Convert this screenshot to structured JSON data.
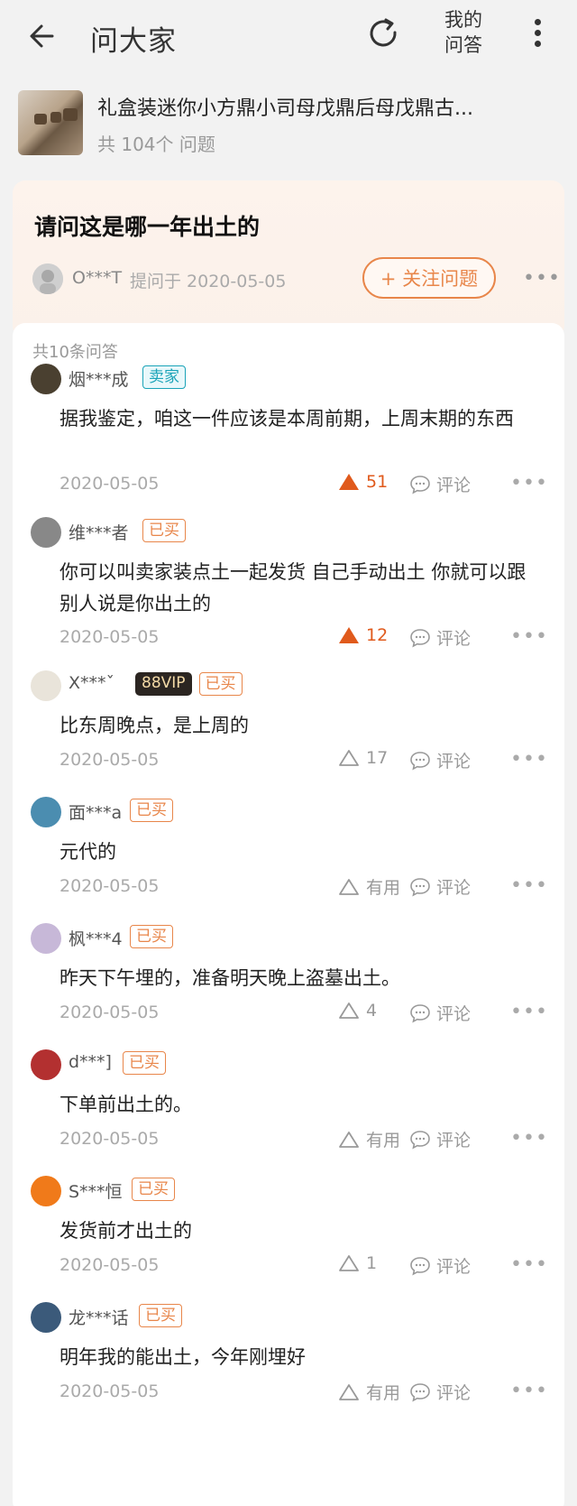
{
  "header": {
    "title": "问大家",
    "my_qa_line1": "我的",
    "my_qa_line2": "问答"
  },
  "product": {
    "name": "礼盒装迷你小方鼎小司母戊鼎后母戊鼎古...",
    "count": "共 104个 问题"
  },
  "question": {
    "title": "请问这是哪一年出土的",
    "asker": "O***T",
    "asked_at": "提问于 2020-05-05",
    "follow_label": "+ 关注问题",
    "more": "•••"
  },
  "answers_count": "共10条问答",
  "comment_label": "评论",
  "more_label": "•••",
  "accent_color": "#e8864a",
  "hot_color": "#e05a1c",
  "answers": [
    {
      "user": "烟***成",
      "badges": [
        "卖家"
      ],
      "text": "据我鉴定，咱这一件应该是本周前期，上周末期的东西",
      "date": "2020-05-05",
      "votes": "51",
      "hot": true
    },
    {
      "user": "维***者",
      "badges": [
        "已买"
      ],
      "text": "你可以叫卖家装点土一起发货  自己手动出土  你就可以跟别人说是你出土的",
      "date": "2020-05-05",
      "votes": "12",
      "hot": true
    },
    {
      "user": "X***ˇ",
      "badges": [
        "88VIP",
        "已买"
      ],
      "text": "比东周晚点，是上周的",
      "date": "2020-05-05",
      "votes": "17",
      "hot": false
    },
    {
      "user": "面***a",
      "badges": [
        "已买"
      ],
      "text": "元代的",
      "date": "2020-05-05",
      "votes": "有用",
      "hot": false
    },
    {
      "user": "枫***4",
      "badges": [
        "已买"
      ],
      "text": "昨天下午埋的，准备明天晚上盗墓出土。",
      "date": "2020-05-05",
      "votes": "4",
      "hot": false
    },
    {
      "user": "d***]",
      "badges": [
        "已买"
      ],
      "text": "下单前出土的。",
      "date": "2020-05-05",
      "votes": "有用",
      "hot": false
    },
    {
      "user": "S***恒",
      "badges": [
        "已买"
      ],
      "text": "发货前才出土的",
      "date": "2020-05-05",
      "votes": "1",
      "hot": false
    },
    {
      "user": "龙***话",
      "badges": [
        "已买"
      ],
      "text": "明年我的能出土，今年刚埋好",
      "date": "2020-05-05",
      "votes": "有用",
      "hot": false
    }
  ]
}
